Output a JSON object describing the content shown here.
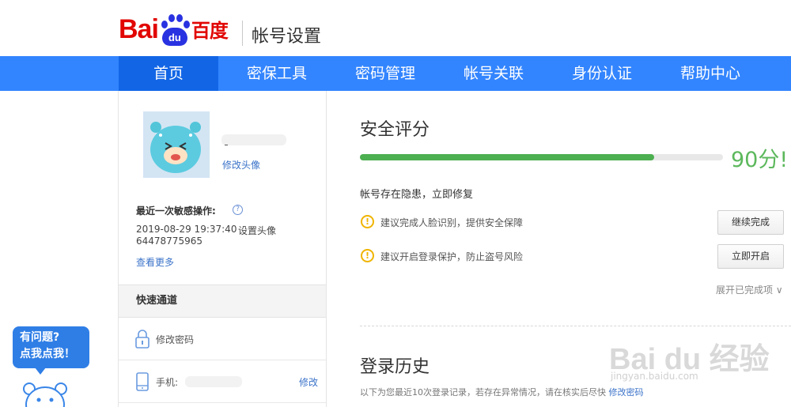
{
  "header": {
    "logo_text_bai": "Bai",
    "logo_text_du": "du",
    "logo_text_cn": "百度",
    "site_title": "帐号设置"
  },
  "nav": {
    "items": [
      {
        "label": "首页",
        "active": true
      },
      {
        "label": "密保工具",
        "active": false
      },
      {
        "label": "密码管理",
        "active": false
      },
      {
        "label": "帐号关联",
        "active": false
      },
      {
        "label": "身份认证",
        "active": false
      },
      {
        "label": "帮助中心",
        "active": false
      }
    ]
  },
  "profile": {
    "username_separator": "-",
    "edit_avatar_label": "修改头像"
  },
  "recent": {
    "title": "最近一次敏感操作:",
    "help_icon": "?",
    "time": "2019-08-29 19:37:40",
    "action": "设置头像",
    "id": "64478775965",
    "see_more": "查看更多"
  },
  "quick": {
    "title": "快速通道",
    "rows": [
      {
        "icon": "lock-icon",
        "label": "修改密码",
        "link": ""
      },
      {
        "icon": "phone-icon",
        "label": "手机:",
        "link": "修改"
      }
    ]
  },
  "security": {
    "title": "安全评分",
    "score_percent": 90,
    "score_text": "90分!",
    "risk_title": "帐号存在隐患，立即修复",
    "items": [
      {
        "icon": "warning-icon",
        "text": "建议完成人脸识别，提供安全保障",
        "button": "继续完成"
      },
      {
        "icon": "warning-icon",
        "text": "建议开启登录保护，防止盗号风险",
        "button": "立即开启"
      }
    ],
    "expand": "展开已完成项 ∨",
    "colors": {
      "bar": "#4caf50",
      "score": "#5cb85c",
      "warning": "#f0b400"
    }
  },
  "login_history": {
    "title": "登录历史",
    "desc": "以下为您最近10次登录记录，若存在异常情况，请在核实后尽快",
    "desc_link": "修改密码"
  },
  "help_widget": {
    "line1": "有问题?",
    "line2": "点我点我！"
  },
  "watermark": {
    "text": "Bai du 经验",
    "url": "jingyan.baidu.com"
  },
  "colors": {
    "brand_blue": "#3385ff",
    "nav_active": "#1266e6",
    "logo_red": "#e10602",
    "link": "#3b73c9"
  }
}
